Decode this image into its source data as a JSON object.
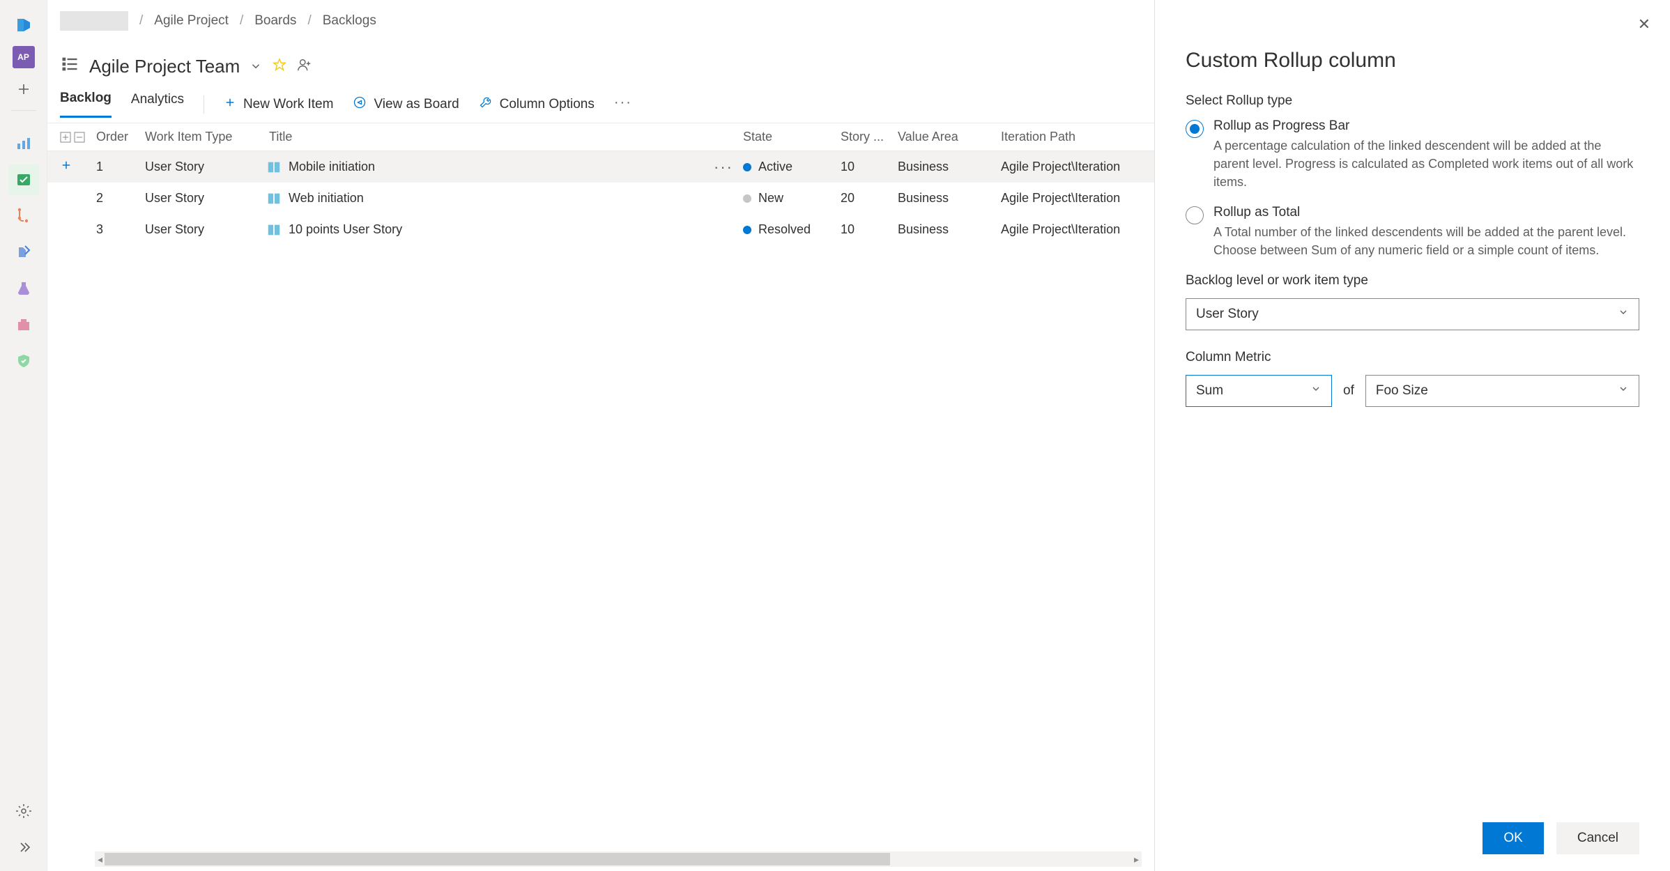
{
  "breadcrumb": {
    "item1": "Agile Project",
    "item2": "Boards",
    "item3": "Backlogs"
  },
  "header": {
    "title": "Agile Project Team"
  },
  "leftRail": {
    "avatar": "AP"
  },
  "tabs": {
    "backlog": "Backlog",
    "analytics": "Analytics",
    "newItem": "New Work Item",
    "viewBoard": "View as Board",
    "colOptions": "Column Options"
  },
  "columns": {
    "order": "Order",
    "type": "Work Item Type",
    "title": "Title",
    "state": "State",
    "story": "Story ...",
    "value": "Value Area",
    "iter": "Iteration Path"
  },
  "rows": [
    {
      "order": "1",
      "type": "User Story",
      "title": "Mobile initiation",
      "state": "Active",
      "stateClass": "dot-active",
      "story": "10",
      "value": "Business",
      "iter": "Agile Project\\Iteration",
      "hover": true
    },
    {
      "order": "2",
      "type": "User Story",
      "title": "Web initiation",
      "state": "New",
      "stateClass": "dot-new",
      "story": "20",
      "value": "Business",
      "iter": "Agile Project\\Iteration",
      "hover": false
    },
    {
      "order": "3",
      "type": "User Story",
      "title": "10 points User Story",
      "state": "Resolved",
      "stateClass": "dot-resolved",
      "story": "10",
      "value": "Business",
      "iter": "Agile Project\\Iteration",
      "hover": false
    }
  ],
  "panel": {
    "title": "Custom Rollup column",
    "typeLabel": "Select Rollup type",
    "opt1Title": "Rollup as Progress Bar",
    "opt1Desc": "A percentage calculation of the linked descendent will be added at the parent level. Progress is calculated as Completed work items out of all work items.",
    "opt2Title": "Rollup as Total",
    "opt2Desc": "A Total number of the linked descendents will be added at the parent level. Choose between Sum of any numeric field or a simple count of items.",
    "levelLabel": "Backlog level or work item type",
    "levelValue": "User Story",
    "metricLabel": "Column Metric",
    "metricValue": "Sum",
    "of": "of",
    "fieldValue": "Foo Size",
    "ok": "OK",
    "cancel": "Cancel"
  }
}
